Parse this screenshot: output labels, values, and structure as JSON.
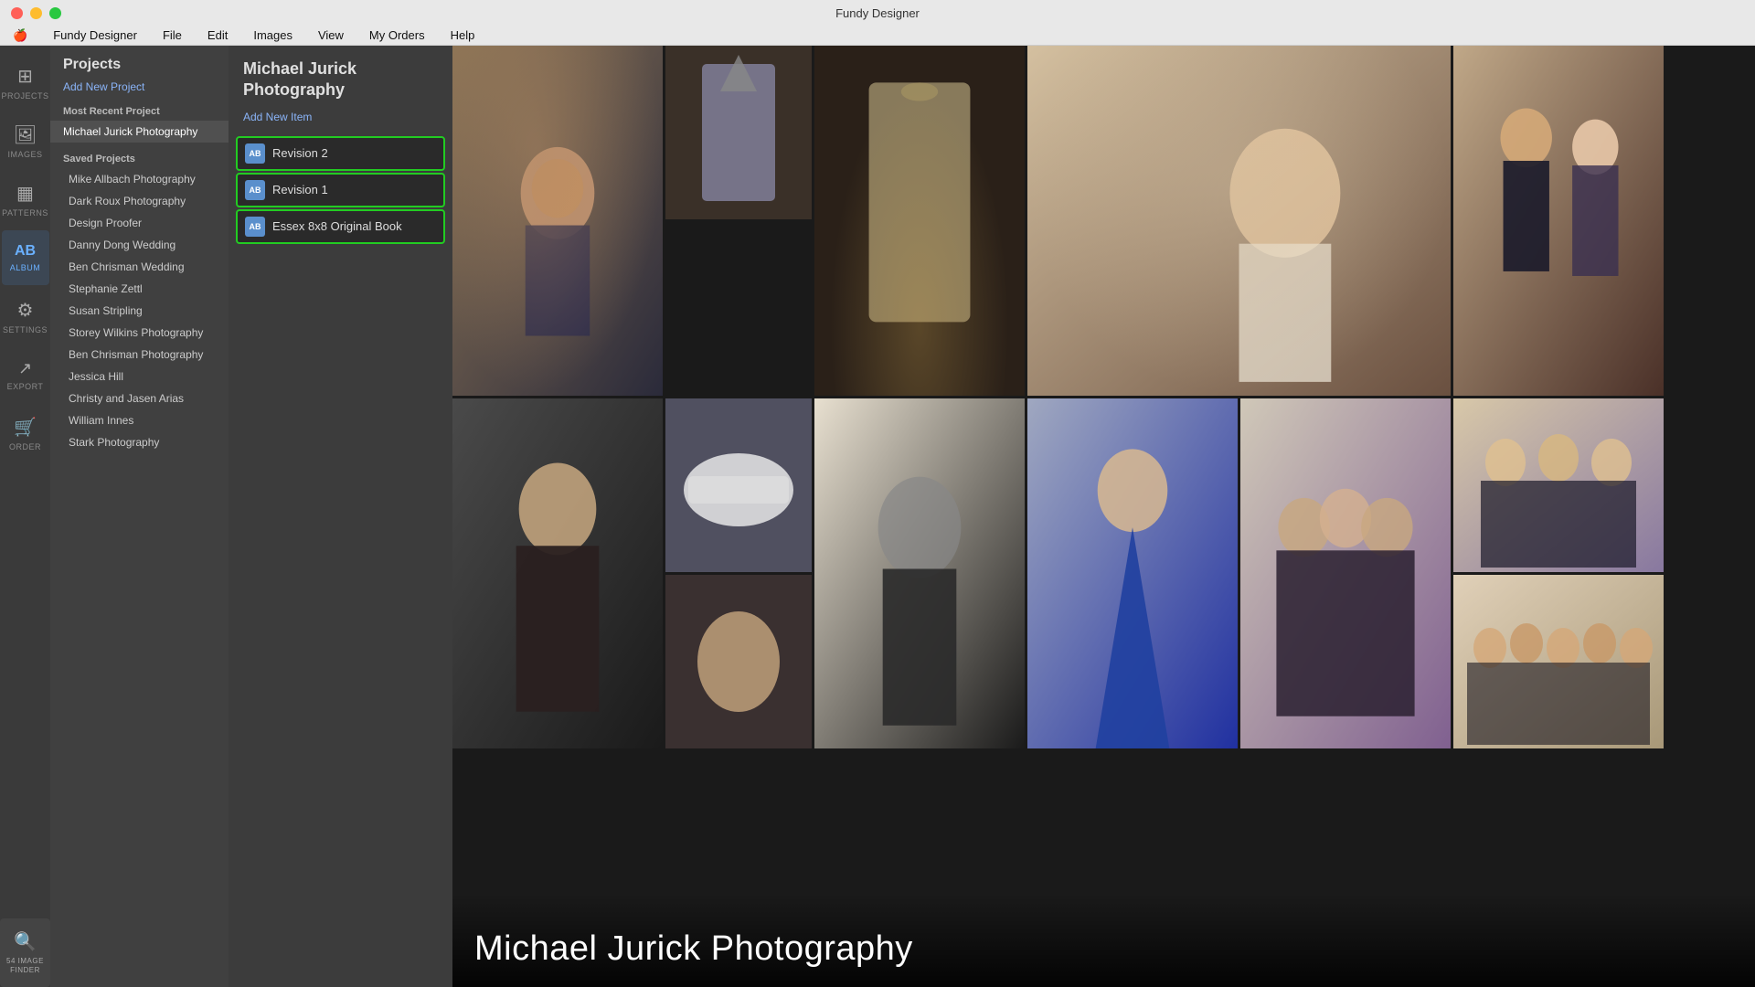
{
  "titleBar": {
    "title": "Fundy Designer"
  },
  "menuBar": {
    "appName": "Fundy Designer",
    "items": [
      "File",
      "Edit",
      "Images",
      "View",
      "My Orders",
      "Help"
    ]
  },
  "iconSidebar": {
    "items": [
      {
        "id": "projects",
        "label": "PROJECTS",
        "glyph": "⊞",
        "active": false
      },
      {
        "id": "images",
        "label": "IMAGES",
        "glyph": "🖼",
        "active": false
      },
      {
        "id": "patterns",
        "label": "PATTERNS",
        "glyph": "▦",
        "active": false
      },
      {
        "id": "album",
        "label": "ALBUM",
        "glyph": "AB",
        "active": true
      },
      {
        "id": "settings",
        "label": "SETTINGS",
        "glyph": "⚙",
        "active": false
      },
      {
        "id": "export",
        "label": "EXPORT",
        "glyph": "↗",
        "active": false
      },
      {
        "id": "order",
        "label": "ORDER",
        "glyph": "🛒",
        "active": false
      },
      {
        "id": "image-finder",
        "label": "IMAGE FINDER",
        "glyph": "🔍",
        "active": false
      }
    ]
  },
  "projectsPanel": {
    "title": "Projects",
    "addNewLabel": "Add New Project",
    "mostRecentLabel": "Most Recent Project",
    "mostRecentItem": "Michael Jurick Photography",
    "savedProjectsLabel": "Saved Projects",
    "savedProjects": [
      "Mike Allbach Photography",
      "Dark Roux Photography",
      "Design Proofer",
      "Danny Dong Wedding",
      "Ben Chrisman Wedding",
      "Stephanie Zettl",
      "Susan Stripling",
      "Storey Wilkins Photography",
      "Ben Chrisman Photography",
      "Jessica Hill",
      "Christy and Jasen Arias",
      "William Innes",
      "Stark Photography"
    ]
  },
  "detailPanel": {
    "title": "Michael Jurick Photography",
    "addNewLabel": "Add New Item",
    "revisions": [
      {
        "id": "revision-2",
        "label": "Revision 2",
        "iconText": "AB"
      },
      {
        "id": "revision-1",
        "label": "Revision 1",
        "iconText": "AB"
      },
      {
        "id": "essex-book",
        "label": "Essex 8x8 Original Book",
        "iconText": "AB"
      }
    ]
  },
  "mainContent": {
    "projectTitle": "Michael Jurick Photography"
  },
  "bottomBar": {
    "imageFinderLabel": "54 IMAGE FINDER"
  }
}
